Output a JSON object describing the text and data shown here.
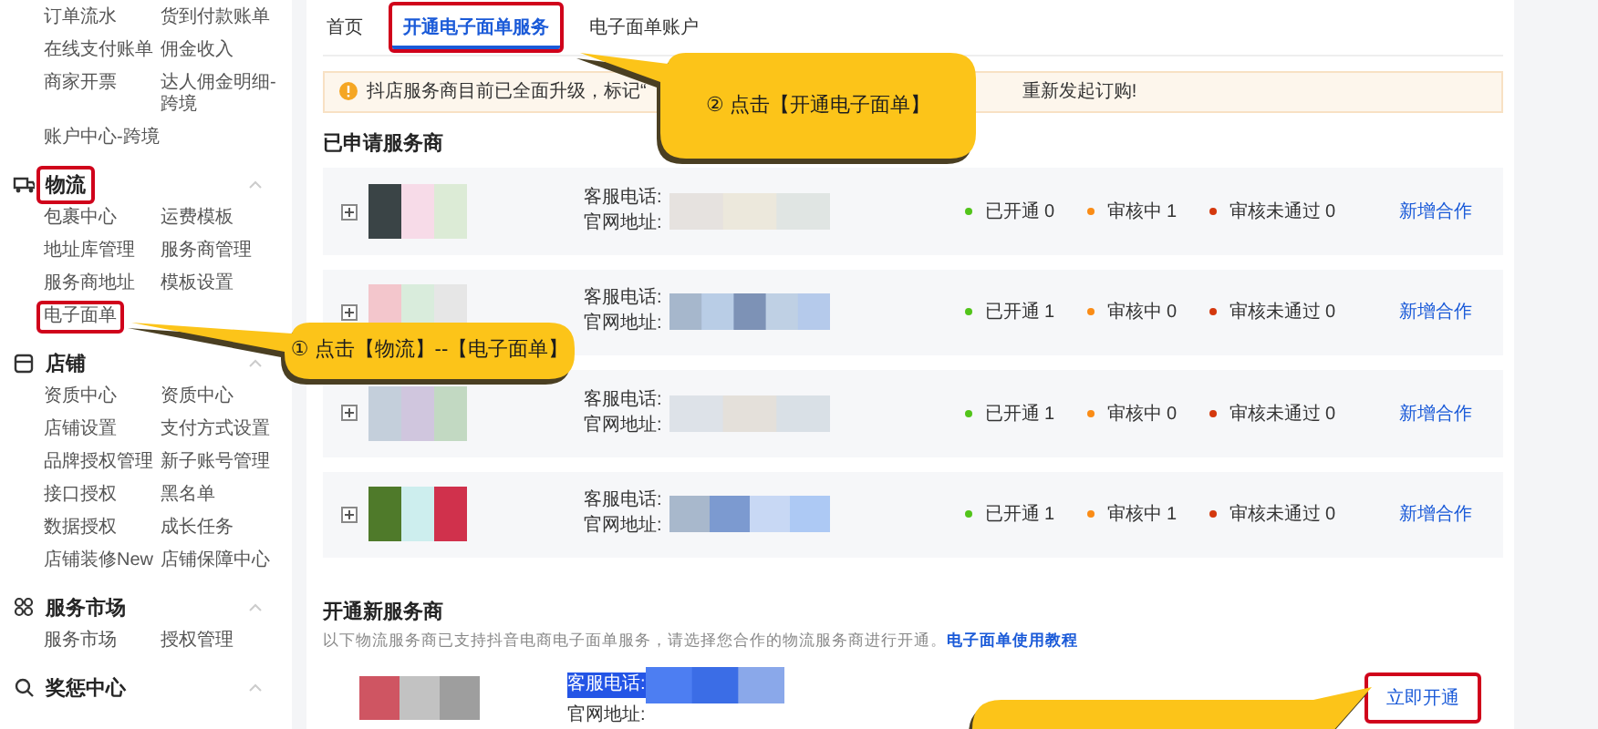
{
  "sidebar": {
    "groups": [
      {
        "items": [
          {
            "label": "订单流水",
            "highlighted": false
          },
          {
            "label": "货到付款账单",
            "highlighted": false
          },
          {
            "label": "在线支付账单",
            "highlighted": false
          },
          {
            "label": "佣金收入",
            "highlighted": false
          },
          {
            "label": "商家开票",
            "highlighted": false
          },
          {
            "label": "达人佣金明细-跨境",
            "highlighted": false
          },
          {
            "label": "账户中心-跨境",
            "highlighted": false
          }
        ]
      },
      {
        "title": "物流",
        "highlighted": true,
        "items": [
          {
            "label": "包裹中心",
            "highlighted": false
          },
          {
            "label": "运费模板",
            "highlighted": false
          },
          {
            "label": "地址库管理",
            "highlighted": false
          },
          {
            "label": "服务商管理",
            "highlighted": false
          },
          {
            "label": "服务商地址",
            "highlighted": false
          },
          {
            "label": "模板设置",
            "highlighted": false
          },
          {
            "label": "电子面单",
            "highlighted": true
          }
        ]
      },
      {
        "title": "店铺",
        "highlighted": false,
        "items": [
          {
            "label": "资质中心",
            "highlighted": false
          },
          {
            "label": "资质中心",
            "highlighted": false
          },
          {
            "label": "店铺设置",
            "highlighted": false
          },
          {
            "label": "支付方式设置",
            "highlighted": false
          },
          {
            "label": "品牌授权管理",
            "highlighted": false
          },
          {
            "label": "新子账号管理",
            "highlighted": false
          },
          {
            "label": "接口授权",
            "highlighted": false
          },
          {
            "label": "黑名单",
            "highlighted": false
          },
          {
            "label": "数据授权",
            "highlighted": false
          },
          {
            "label": "成长任务",
            "highlighted": false
          },
          {
            "label": "店铺装修New",
            "highlighted": false
          },
          {
            "label": "店铺保障中心",
            "highlighted": false
          }
        ]
      },
      {
        "title": "服务市场",
        "highlighted": false,
        "items": [
          {
            "label": "服务市场",
            "highlighted": false
          },
          {
            "label": "授权管理",
            "highlighted": false
          }
        ]
      },
      {
        "title": "奖惩中心",
        "highlighted": false
      }
    ]
  },
  "tabs": [
    {
      "label": "首页",
      "selected": false,
      "highlighted": false
    },
    {
      "label": "开通电子面单服务",
      "selected": true,
      "highlighted": true
    },
    {
      "label": "电子面单账户",
      "selected": false,
      "highlighted": false
    }
  ],
  "notice": {
    "text_before": "抖店服务商目前已全面升级，标记“",
    "text_after": "重新发起订购!"
  },
  "applied": {
    "title": "已申请服务商",
    "providers": [
      {
        "phone_label": "客服电话:",
        "site_label": "官网地址:",
        "stats": [
          {
            "label": "已开通 0",
            "color": "#52c41a"
          },
          {
            "label": "审核中 1",
            "color": "#fa8c16"
          },
          {
            "label": "审核未通过 0",
            "color": "#d4380d"
          }
        ],
        "action": "新增合作"
      },
      {
        "phone_label": "客服电话:",
        "site_label": "官网地址:",
        "stats": [
          {
            "label": "已开通 1",
            "color": "#52c41a"
          },
          {
            "label": "审核中 0",
            "color": "#fa8c16"
          },
          {
            "label": "审核未通过 0",
            "color": "#d4380d"
          }
        ],
        "action": "新增合作"
      },
      {
        "phone_label": "客服电话:",
        "site_label": "官网地址:",
        "stats": [
          {
            "label": "已开通 1",
            "color": "#52c41a"
          },
          {
            "label": "审核中 0",
            "color": "#fa8c16"
          },
          {
            "label": "审核未通过 0",
            "color": "#d4380d"
          }
        ],
        "action": "新增合作"
      },
      {
        "phone_label": "客服电话:",
        "site_label": "官网地址:",
        "stats": [
          {
            "label": "已开通 1",
            "color": "#52c41a"
          },
          {
            "label": "审核中 1",
            "color": "#fa8c16"
          },
          {
            "label": "审核未通过 0",
            "color": "#d4380d"
          }
        ],
        "action": "新增合作"
      }
    ]
  },
  "new_providers": {
    "title": "开通新服务商",
    "description": "以下物流服务商已支持抖音电商电子面单服务，请选择您合作的物流服务商进行开通。",
    "link": "电子面单使用教程",
    "providers": [
      {
        "phone_label": "客服电话:",
        "phone_selected": true,
        "site_label": "官网地址:",
        "button": "立即开通",
        "highlighted": true
      }
    ]
  },
  "callouts": [
    {
      "kind": "left",
      "text": "① 点击【物流】--【电子面单】"
    },
    {
      "kind": "left",
      "text": "② 点击【开通电子面单】"
    },
    {
      "kind": "right"
    }
  ]
}
